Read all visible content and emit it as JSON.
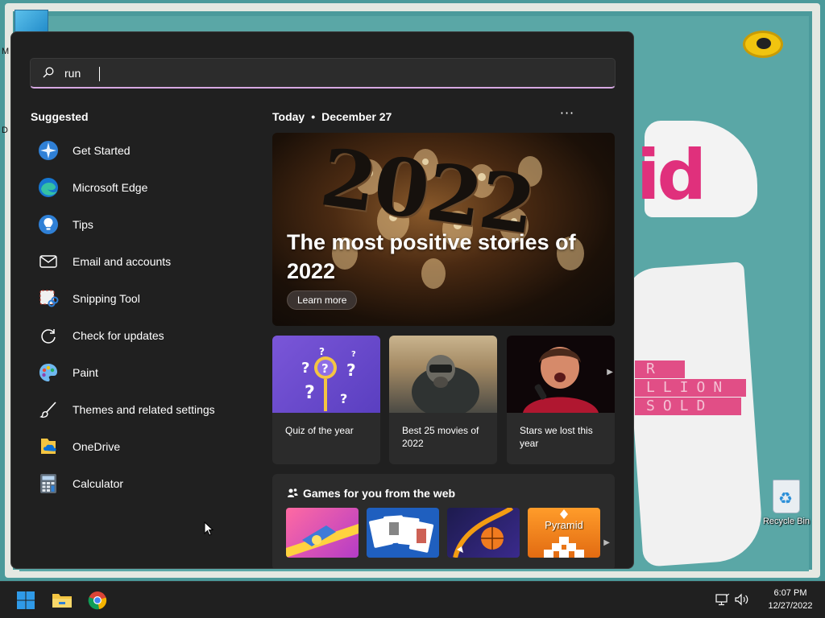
{
  "search": {
    "value": "run",
    "placeholder": ""
  },
  "suggested": {
    "title": "Suggested",
    "items": [
      {
        "label": "Get Started",
        "icon": "get-started-icon"
      },
      {
        "label": "Microsoft Edge",
        "icon": "edge-icon"
      },
      {
        "label": "Tips",
        "icon": "tips-icon"
      },
      {
        "label": "Email and accounts",
        "icon": "mail-icon"
      },
      {
        "label": "Snipping Tool",
        "icon": "snipping-tool-icon"
      },
      {
        "label": "Check for updates",
        "icon": "refresh-icon"
      },
      {
        "label": "Paint",
        "icon": "paint-icon"
      },
      {
        "label": "Themes and related settings",
        "icon": "brush-icon"
      },
      {
        "label": "OneDrive",
        "icon": "onedrive-icon"
      },
      {
        "label": "Calculator",
        "icon": "calculator-icon"
      }
    ]
  },
  "today": {
    "label": "Today",
    "separator": "•",
    "date": "December 27",
    "more": "···"
  },
  "hero": {
    "number_art": "2022",
    "title": "The most positive stories of 2022",
    "button": "Learn more"
  },
  "cards": [
    {
      "label": "Quiz of the year"
    },
    {
      "label": "Best 25 movies of 2022"
    },
    {
      "label": "Stars we lost this year"
    }
  ],
  "games": {
    "title": "Games for you from the web",
    "pyramid_label": "Pyramid"
  },
  "desktop": {
    "recycle_bin": "Recycle Bin"
  },
  "taskbar": {
    "time": "6:07 PM",
    "date": "12/27/2022"
  },
  "colors": {
    "start_bg": "#202020",
    "search_accent": "#d7a9e3",
    "taskbar_bg": "#202020",
    "windows_blue": "#0a84d8"
  }
}
